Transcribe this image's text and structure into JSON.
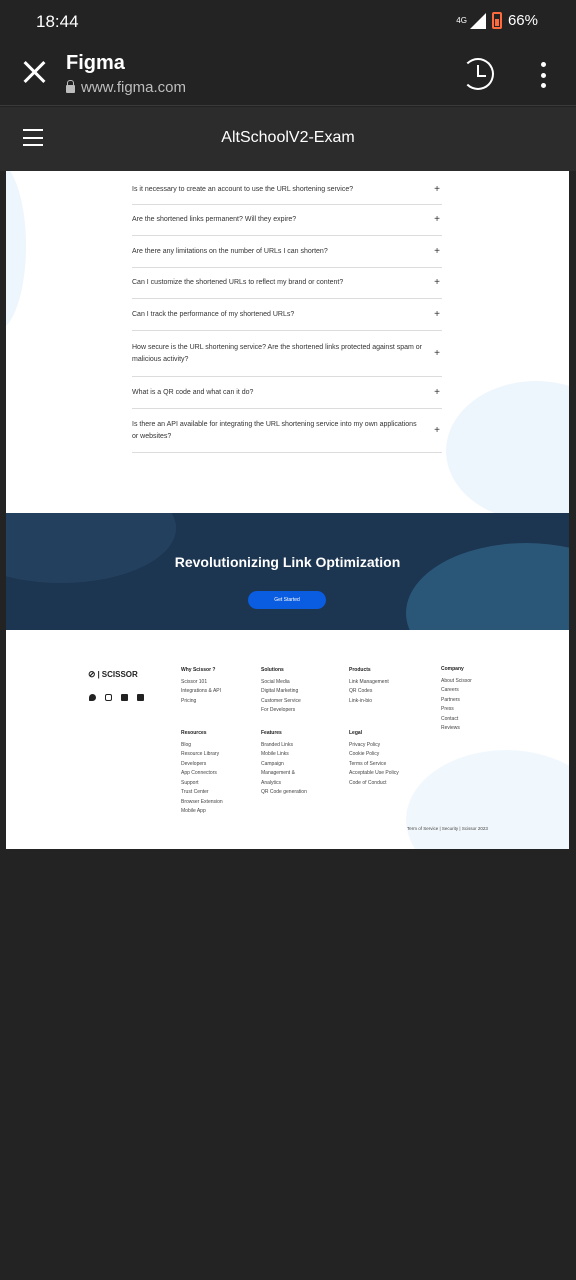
{
  "status_bar": {
    "time": "18:44",
    "network": "4G",
    "battery": "66%"
  },
  "browser": {
    "title": "Figma",
    "url": "www.figma.com"
  },
  "figma": {
    "file_title": "AltSchoolV2-Exam"
  },
  "faq": [
    "Is it necessary to create an account to use the URL shortening service?",
    "Are the shortened links permanent? Will they expire?",
    "Are there any limitations on the number of URLs I can shorten?",
    "Can I customize the shortened URLs to reflect my brand or content?",
    "Can I track the performance of my shortened URLs?",
    "How secure is the URL shortening service? Are the shortened links protected against spam or malicious activity?",
    "What is a QR code and what can it do?",
    "Is there an API available for integrating the URL shortening service into my own applications or websites?"
  ],
  "faq_plus": "+",
  "cta": {
    "title": "Revolutionizing Link Optimization",
    "button": "Get Started"
  },
  "footer": {
    "brand": "SCISSOR",
    "columns": [
      {
        "heading": "Why Scissor ?",
        "items": [
          "Scissor 101",
          "Integrations & API",
          "Pricing"
        ]
      },
      {
        "heading": "Solutions",
        "items": [
          "Social Media",
          "Digital Marketing",
          "Customer Service",
          "For Developers"
        ]
      },
      {
        "heading": "Products",
        "items": [
          "Link Management",
          "QR Codes",
          "Link-in-bio"
        ]
      },
      {
        "heading": "Company",
        "items": [
          "About Scissor",
          "Careers",
          "Partners",
          "Press",
          "Contact",
          "Reviews"
        ]
      },
      {
        "heading": "Resources",
        "items": [
          "Blog",
          "Resource Library",
          "Developers",
          "App Connectors",
          "Support",
          "Trust Center",
          "Browser Extension",
          "Mobile App"
        ]
      },
      {
        "heading": "Features",
        "items": [
          "Branded Links",
          "Mobile Links",
          "Campaign",
          "Management &",
          "Analytics",
          "QR Code generation"
        ]
      },
      {
        "heading": "Legal",
        "items": [
          "Privacy Policy",
          "Cookie Policy",
          "Terms of Service",
          "Acceptable Use Policy",
          "Code of Conduct"
        ]
      }
    ],
    "legal_bar": "Term of Service | Security | Scissor 2023"
  }
}
